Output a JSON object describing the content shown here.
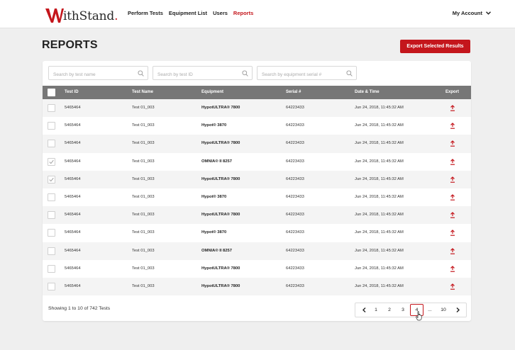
{
  "brand": {
    "logo_letter": "W",
    "logo_text": "ithStand",
    "logo_dot": ".",
    "accent_color": "#c4161c"
  },
  "nav": {
    "items": [
      {
        "label": "Perform Tests",
        "active": false
      },
      {
        "label": "Equipment List",
        "active": false
      },
      {
        "label": "Users",
        "active": false
      },
      {
        "label": "Reports",
        "active": true
      }
    ],
    "account_label": "My Account"
  },
  "page": {
    "title": "REPORTS",
    "export_button": "Export Selected Results"
  },
  "filters": [
    {
      "placeholder": "Search by test name",
      "icon": "search-icon"
    },
    {
      "placeholder": "Search by test ID",
      "icon": "search-icon"
    },
    {
      "placeholder": "Search by equipment serial #",
      "icon": "search-icon"
    }
  ],
  "table": {
    "headers": {
      "test_id": "Test ID",
      "test_name": "Test Name",
      "equipment": "Equipment",
      "serial": "Serial #",
      "date": "Date & Time",
      "export": "Export"
    },
    "rows": [
      {
        "checked": false,
        "test_id": "5465464",
        "test_name": "Test 01_003",
        "equipment": "HypotULTRA® 7800",
        "serial": "64223433",
        "date": "Jun 24, 2018, 11:45:32 AM"
      },
      {
        "checked": false,
        "test_id": "5465464",
        "test_name": "Test 01_003",
        "equipment": "Hypot® 3870",
        "serial": "64223433",
        "date": "Jun 24, 2018, 11:45:32 AM"
      },
      {
        "checked": false,
        "test_id": "5465464",
        "test_name": "Test 01_003",
        "equipment": "HypotULTRA® 7800",
        "serial": "64223433",
        "date": "Jun 24, 2018, 11:45:32 AM"
      },
      {
        "checked": true,
        "test_id": "5465464",
        "test_name": "Test 01_003",
        "equipment": "OMNIA® II 8257",
        "serial": "64223433",
        "date": "Jun 24, 2018, 11:45:32 AM"
      },
      {
        "checked": true,
        "test_id": "5465464",
        "test_name": "Test 01_003",
        "equipment": "HypotULTRA® 7800",
        "serial": "64223433",
        "date": "Jun 24, 2018, 11:45:32 AM"
      },
      {
        "checked": false,
        "test_id": "5465464",
        "test_name": "Test 01_003",
        "equipment": "Hypot® 3870",
        "serial": "64223433",
        "date": "Jun 24, 2018, 11:45:32 AM"
      },
      {
        "checked": false,
        "test_id": "5465464",
        "test_name": "Test 01_003",
        "equipment": "HypotULTRA® 7800",
        "serial": "64223433",
        "date": "Jun 24, 2018, 11:45:32 AM"
      },
      {
        "checked": false,
        "test_id": "5465464",
        "test_name": "Test 01_003",
        "equipment": "Hypot® 3870",
        "serial": "64223433",
        "date": "Jun 24, 2018, 11:45:32 AM"
      },
      {
        "checked": false,
        "test_id": "5465464",
        "test_name": "Test 01_003",
        "equipment": "OMNIA® II 8257",
        "serial": "64223433",
        "date": "Jun 24, 2018, 11:45:32 AM"
      },
      {
        "checked": false,
        "test_id": "5465464",
        "test_name": "Test 01_003",
        "equipment": "HypotULTRA® 7800",
        "serial": "64223433",
        "date": "Jun 24, 2018, 11:45:32 AM"
      },
      {
        "checked": false,
        "test_id": "5465464",
        "test_name": "Test 01_003",
        "equipment": "HypotULTRA® 7800",
        "serial": "64223433",
        "date": "Jun 24, 2018, 11:45:32 AM"
      }
    ],
    "export_icon": "upload-icon"
  },
  "footer": {
    "showing_text": "Showing 1 to 10 of 742 Tests",
    "pages": [
      "1",
      "2",
      "3",
      "4",
      "...",
      "10"
    ],
    "current_page": "4"
  }
}
